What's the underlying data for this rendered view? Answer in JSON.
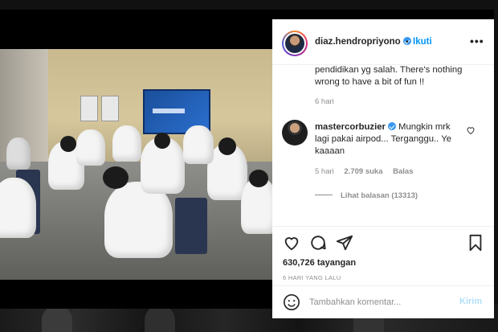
{
  "post": {
    "username": "diaz.hendropriyono",
    "follow_label": "Ikuti",
    "more_label": "•••",
    "dot": "•"
  },
  "caption": {
    "text": "pendidikan yg salah. There's nothing wrong to have a bit of fun !!",
    "time": "6 hari"
  },
  "comment": {
    "username": "mastercorbuzier",
    "text": "Mungkin mrk lagi pakai airpod... Terganggu.. Ye kaaaan",
    "time": "5 hari",
    "likes": "2.709 suka",
    "reply_label": "Balas",
    "view_replies": "Lihat balasan (13313)"
  },
  "stats": {
    "views": "630,726 tayangan",
    "posted_ago": "6 HARI YANG LALU"
  },
  "compose": {
    "placeholder": "Tambahkan komentar...",
    "post_label": "Kirim"
  },
  "icons": {
    "verified": "verified-badge-icon",
    "heart": "heart-icon",
    "comment": "comment-icon",
    "share": "paper-plane-icon",
    "save": "bookmark-icon",
    "emoji": "smiley-icon",
    "mute": "speaker-muted-icon"
  },
  "colors": {
    "link_blue": "#0095f6",
    "verified_blue": "#3897f0",
    "muted_text": "#8e8e8e",
    "disabled_blue": "#b2dffc"
  }
}
